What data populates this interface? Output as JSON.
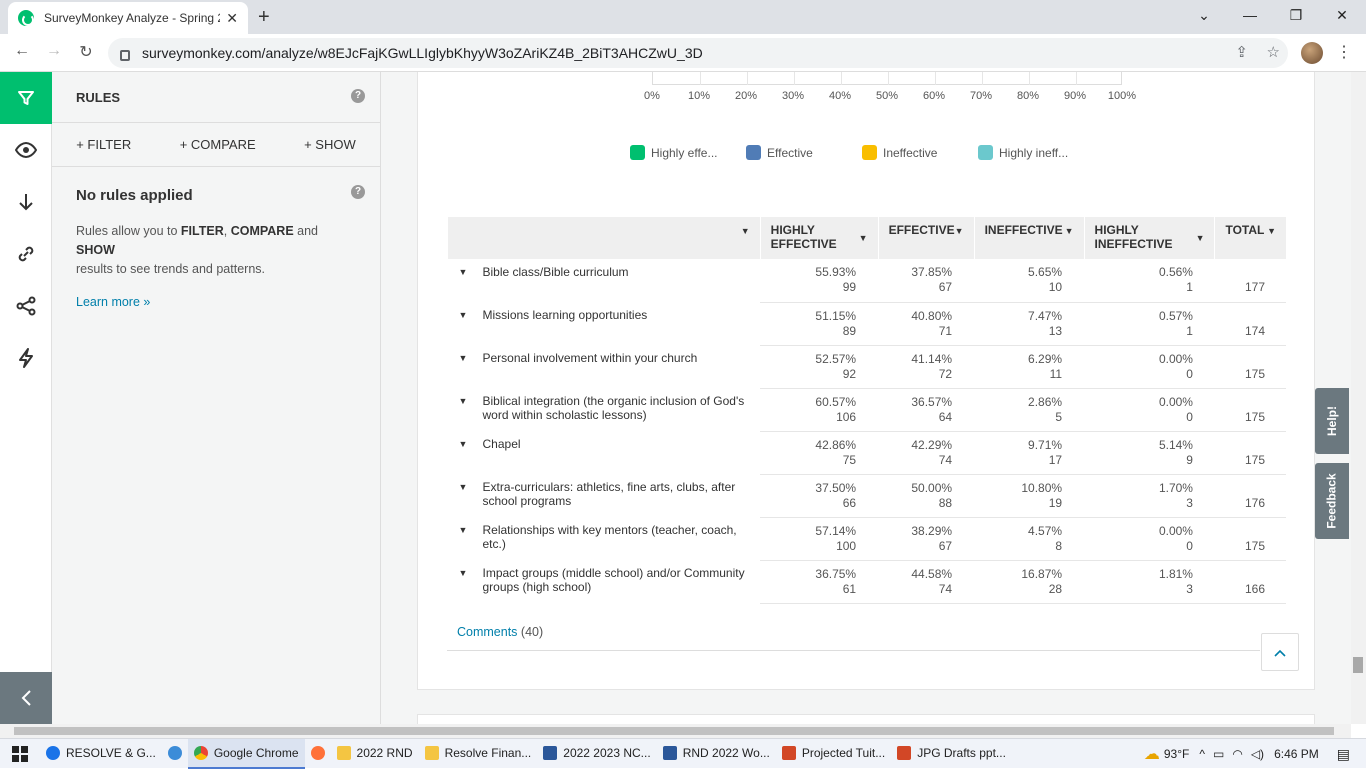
{
  "browser": {
    "tab_title": "SurveyMonkey Analyze - Spring 2",
    "url": "surveymonkey.com/analyze/w8EJcFajKGwLLIglybKhyyW3oZAriKZ4B_2BiT3AHCZwU_3D"
  },
  "rules_panel": {
    "header": "RULES",
    "filter_label": "+ FILTER",
    "compare_label": "+ COMPARE",
    "show_label": "+ SHOW",
    "title": "No rules applied",
    "desc_1": "Rules allow you to ",
    "desc_filter": "FILTER",
    "desc_sep1": ", ",
    "desc_compare": "COMPARE",
    "desc_and": " and ",
    "desc_show": "SHOW",
    "desc_2": "results to see trends and patterns.",
    "learn_more": "Learn more »"
  },
  "chart": {
    "axis_ticks": [
      "0%",
      "10%",
      "20%",
      "30%",
      "40%",
      "50%",
      "60%",
      "70%",
      "80%",
      "90%",
      "100%"
    ],
    "legend": [
      {
        "label": "Highly effe...",
        "color": "#00bf6f"
      },
      {
        "label": "Effective",
        "color": "#507cb6"
      },
      {
        "label": "Ineffective",
        "color": "#f9be00"
      },
      {
        "label": "Highly ineff...",
        "color": "#6bc8cd"
      }
    ]
  },
  "table": {
    "headers": [
      "HIGHLY EFFECTIVE",
      "EFFECTIVE",
      "INEFFECTIVE",
      "HIGHLY INEFFECTIVE",
      "TOTAL"
    ],
    "rows": [
      {
        "label": "Bible class/Bible curriculum",
        "he_p": "55.93%",
        "he_n": "99",
        "e_p": "37.85%",
        "e_n": "67",
        "i_p": "5.65%",
        "i_n": "10",
        "hi_p": "0.56%",
        "hi_n": "1",
        "total": "177"
      },
      {
        "label": "Missions learning opportunities",
        "he_p": "51.15%",
        "he_n": "89",
        "e_p": "40.80%",
        "e_n": "71",
        "i_p": "7.47%",
        "i_n": "13",
        "hi_p": "0.57%",
        "hi_n": "1",
        "total": "174"
      },
      {
        "label": "Personal involvement within your church",
        "he_p": "52.57%",
        "he_n": "92",
        "e_p": "41.14%",
        "e_n": "72",
        "i_p": "6.29%",
        "i_n": "11",
        "hi_p": "0.00%",
        "hi_n": "0",
        "total": "175"
      },
      {
        "label": "Biblical integration (the organic inclusion of God's word within scholastic lessons)",
        "he_p": "60.57%",
        "he_n": "106",
        "e_p": "36.57%",
        "e_n": "64",
        "i_p": "2.86%",
        "i_n": "5",
        "hi_p": "0.00%",
        "hi_n": "0",
        "total": "175"
      },
      {
        "label": "Chapel",
        "he_p": "42.86%",
        "he_n": "75",
        "e_p": "42.29%",
        "e_n": "74",
        "i_p": "9.71%",
        "i_n": "17",
        "hi_p": "5.14%",
        "hi_n": "9",
        "total": "175"
      },
      {
        "label": "Extra-curriculars: athletics, fine arts, clubs, after school programs",
        "he_p": "37.50%",
        "he_n": "66",
        "e_p": "50.00%",
        "e_n": "88",
        "i_p": "10.80%",
        "i_n": "19",
        "hi_p": "1.70%",
        "hi_n": "3",
        "total": "176"
      },
      {
        "label": "Relationships with key mentors (teacher, coach, etc.)",
        "he_p": "57.14%",
        "he_n": "100",
        "e_p": "38.29%",
        "e_n": "67",
        "i_p": "4.57%",
        "i_n": "8",
        "hi_p": "0.00%",
        "hi_n": "0",
        "total": "175"
      },
      {
        "label": "Impact groups (middle school) and/or Community groups (high school)",
        "he_p": "36.75%",
        "he_n": "61",
        "e_p": "44.58%",
        "e_n": "74",
        "i_p": "16.87%",
        "i_n": "28",
        "hi_p": "1.81%",
        "hi_n": "3",
        "total": "166"
      }
    ]
  },
  "comments": {
    "label": "Comments",
    "count": "(40)"
  },
  "side_tabs": {
    "help": "Help!",
    "feedback": "Feedback"
  },
  "taskbar": {
    "items": [
      {
        "label": "RESOLVE & G...",
        "color": "#1a73e8"
      },
      {
        "label": "Google Chrome",
        "color": "#ea4335"
      },
      {
        "label": "2022 RND",
        "color": "#f4c542"
      },
      {
        "label": "Resolve Finan...",
        "color": "#f4c542"
      },
      {
        "label": "2022 2023 NC...",
        "color": "#2b579a"
      },
      {
        "label": "RND 2022 Wo...",
        "color": "#2b579a"
      },
      {
        "label": "Projected Tuit...",
        "color": "#d24726"
      },
      {
        "label": "JPG Drafts ppt...",
        "color": "#d24726"
      }
    ],
    "weather": "93°F",
    "time": "6:46 PM"
  }
}
